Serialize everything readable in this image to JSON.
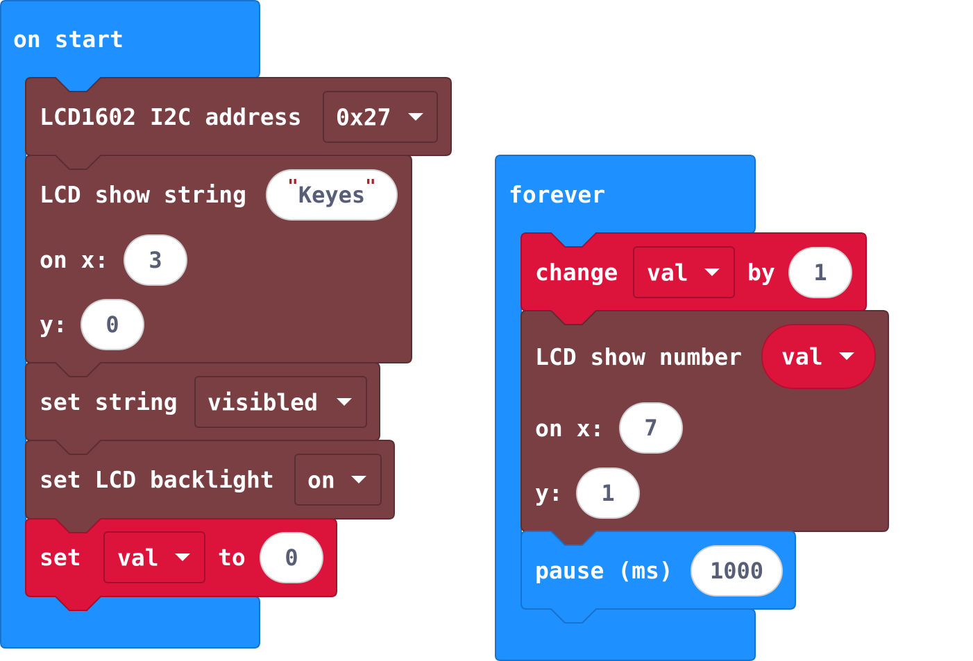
{
  "colors": {
    "event_block": "#1E90FF",
    "lcd_block": "#7A3F43",
    "variable_block": "#DC143C",
    "input_text": "#575E75",
    "string_quote": "#A6232B"
  },
  "on_start": {
    "hat_label": "on start",
    "lcd_init": {
      "label": "LCD1602 I2C address",
      "address": "0x27"
    },
    "show_string": {
      "label": "LCD show string",
      "quote_open": "\"",
      "value": "Keyes",
      "quote_close": "\"",
      "on_x_label": "on x:",
      "x": "3",
      "y_label": "y:",
      "y": "0"
    },
    "set_string": {
      "label": "set string",
      "value": "visibled"
    },
    "set_backlight": {
      "label": "set LCD backlight",
      "value": "on"
    },
    "set_var": {
      "label": "set",
      "variable": "val",
      "to_label": "to",
      "value": "0"
    }
  },
  "forever": {
    "hat_label": "forever",
    "change_var": {
      "label": "change",
      "variable": "val",
      "by_label": "by",
      "value": "1"
    },
    "show_number": {
      "label": "LCD show number",
      "variable": "val",
      "on_x_label": "on x:",
      "x": "7",
      "y_label": "y:",
      "y": "1"
    },
    "pause": {
      "label": "pause (ms)",
      "value": "1000"
    }
  }
}
